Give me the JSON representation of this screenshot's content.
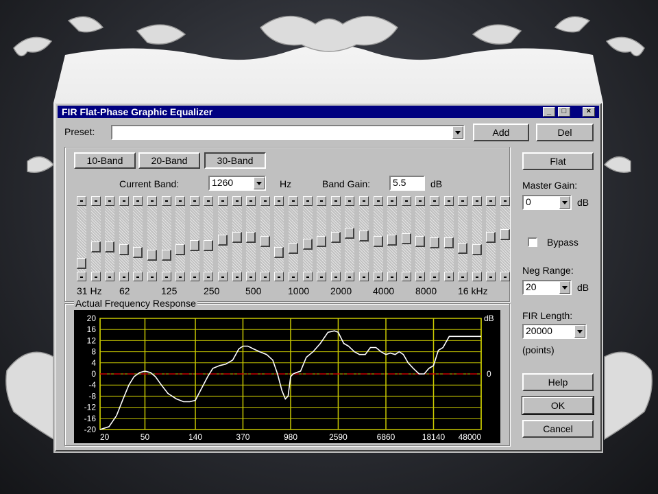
{
  "window": {
    "title": "FIR Flat-Phase Graphic Equalizer",
    "controls": [
      "_",
      "□",
      "×"
    ]
  },
  "preset": {
    "label": "Preset:",
    "value": "",
    "add_label": "Add",
    "del_label": "Del"
  },
  "band_tabs": [
    "10-Band",
    "20-Band",
    "30-Band"
  ],
  "selected_band_tab": "30-Band",
  "current_band": {
    "label": "Current Band:",
    "value": "1260",
    "unit": "Hz"
  },
  "band_gain": {
    "label": "Band Gain:",
    "value": "5.5",
    "unit": "dB"
  },
  "sliders": {
    "count": 30,
    "gain_range_db": [
      -20,
      20
    ],
    "values_db": [
      -18,
      -6,
      -6,
      -8,
      -10,
      -12,
      -12,
      -8,
      -5,
      -5,
      -1,
      1,
      1,
      -2,
      -10,
      -7,
      -4,
      -2,
      1,
      4,
      2,
      -2,
      -1,
      0,
      -2,
      -3,
      -3,
      -7,
      -8,
      1,
      3
    ]
  },
  "freq_labels": [
    "31 Hz",
    "62",
    "125",
    "250",
    "500",
    "1000",
    "2000",
    "4000",
    "8000",
    "16 kHz"
  ],
  "right_panel": {
    "flat_label": "Flat",
    "master_gain_label": "Master Gain:",
    "master_gain_value": "0",
    "master_gain_unit": "dB",
    "bypass_label": "Bypass",
    "bypass_checked": false,
    "neg_range_label": "Neg Range:",
    "neg_range_value": "20",
    "neg_range_unit": "dB",
    "fir_length_label": "FIR Length:",
    "fir_length_value": "20000",
    "fir_length_unit": "(points)",
    "help_label": "Help",
    "ok_label": "OK",
    "cancel_label": "Cancel"
  },
  "response": {
    "title": "Actual Frequency Response",
    "unit_label": "dB",
    "zero_label": "0",
    "y_ticks": [
      20,
      16,
      12,
      8,
      4,
      0,
      -4,
      -8,
      -12,
      -16,
      -20
    ],
    "x_ticks": [
      "20",
      "50",
      "140",
      "370",
      "980",
      "2590",
      "6860",
      "18140",
      "48000"
    ]
  },
  "colors": {
    "grid": "#c8c800",
    "curve": "#ffffff",
    "zero_line": "#cc0000",
    "plot_bg": "#000000",
    "title_bar": "#000080"
  },
  "chart_data": {
    "type": "line",
    "title": "Actual Frequency Response",
    "xlabel": "",
    "ylabel": "dB",
    "x_scale": "log",
    "xlim": [
      20,
      48000
    ],
    "ylim": [
      -20,
      20
    ],
    "grid": true,
    "x_ticks": [
      20,
      50,
      140,
      370,
      980,
      2590,
      6860,
      18140,
      48000
    ],
    "y_ticks": [
      20,
      16,
      12,
      8,
      4,
      0,
      -4,
      -8,
      -12,
      -16,
      -20
    ],
    "reference_line": {
      "y": 0,
      "style": "dash-dot",
      "color": "#cc0000"
    },
    "series": [
      {
        "x": [
          20,
          24,
          28,
          32,
          36,
          40,
          45,
          50,
          56,
          62,
          70,
          80,
          95,
          110,
          125,
          140,
          160,
          180,
          200,
          230,
          260,
          300,
          340,
          370,
          410,
          460,
          520,
          600,
          680,
          750,
          820,
          880,
          930,
          980,
          1030,
          1100,
          1200,
          1350,
          1550,
          1800,
          2100,
          2400,
          2590,
          2900,
          3200,
          3600,
          4000,
          4500,
          5000,
          5600,
          6200,
          6860,
          7500,
          8300,
          9000,
          9800,
          10800,
          12000,
          13500,
          15000,
          16500,
          18140,
          20000,
          22000,
          25000,
          30000,
          38000,
          48000
        ],
        "y": [
          -20,
          -19,
          -15,
          -9,
          -4,
          -1,
          0.5,
          1,
          0.5,
          -1,
          -4,
          -7,
          -9,
          -10,
          -10,
          -9.5,
          -5,
          -1,
          2,
          3,
          3.5,
          5,
          9,
          10,
          10,
          9,
          8,
          7,
          5,
          0,
          -6,
          -9,
          -8,
          -1,
          0,
          0.5,
          1,
          6,
          8,
          11,
          15,
          15.5,
          15,
          11,
          10,
          8,
          7,
          7,
          9.5,
          9.5,
          8,
          7,
          7.5,
          7,
          8,
          7,
          4,
          2,
          0,
          0,
          2,
          3,
          8.5,
          9.5,
          13.5,
          13.5,
          13.5,
          13.5
        ]
      }
    ]
  }
}
